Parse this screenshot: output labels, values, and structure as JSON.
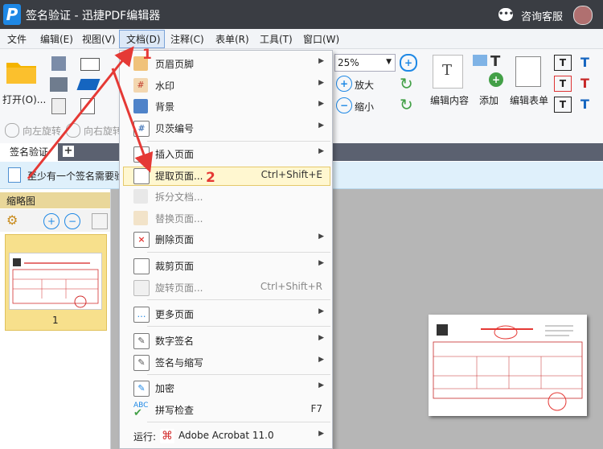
{
  "app": {
    "logo": "P",
    "title": "签名验证 - 迅捷PDF编辑器",
    "support": "咨询客服"
  },
  "menubar": [
    "文件",
    "编辑(E)",
    "视图(V)",
    "文档(D)",
    "注释(C)",
    "表单(R)",
    "工具(T)",
    "窗口(W)"
  ],
  "ribbon": {
    "open": "打开(O)...",
    "rotate_left": "向左旋转",
    "rotate_right": "向右旋转",
    "zoom_value": "25%",
    "zoom_in": "放大",
    "zoom_out": "缩小",
    "edit_content": "编辑内容",
    "add": "添加",
    "edit_form": "编辑表单"
  },
  "tabs": {
    "active": "签名验证",
    "add": "+"
  },
  "notification": "至少有一个签名需要验证",
  "thumbnails": {
    "title": "缩略图",
    "page_number": "1"
  },
  "dropdown": {
    "items": [
      {
        "label": "页眉页脚",
        "icon": "header-footer-icon",
        "submenu": true
      },
      {
        "label": "水印",
        "icon": "watermark-icon",
        "submenu": true
      },
      {
        "label": "背景",
        "icon": "background-icon",
        "submenu": true
      },
      {
        "label": "贝茨编号",
        "icon": "bates-number-icon",
        "submenu": true
      },
      {
        "label": "插入页面",
        "icon": "insert-page-icon",
        "submenu": true
      },
      {
        "label": "提取页面...",
        "icon": "extract-page-icon",
        "shortcut": "Ctrl+Shift+E",
        "highlighted": true
      },
      {
        "label": "拆分文档...",
        "icon": "split-document-icon",
        "disabled": true
      },
      {
        "label": "替换页面...",
        "icon": "replace-page-icon",
        "disabled": true
      },
      {
        "label": "删除页面",
        "icon": "delete-page-icon",
        "submenu": true
      },
      {
        "label": "裁剪页面",
        "icon": "crop-page-icon",
        "submenu": true
      },
      {
        "label": "旋转页面...",
        "icon": "rotate-page-icon",
        "shortcut": "Ctrl+Shift+R",
        "disabled": true
      },
      {
        "label": "更多页面",
        "icon": "more-pages-icon",
        "submenu": true
      },
      {
        "label": "数字签名",
        "icon": "digital-signature-icon",
        "submenu": true
      },
      {
        "label": "签名与缩写",
        "icon": "sign-initials-icon",
        "submenu": true
      },
      {
        "label": "加密",
        "icon": "encrypt-icon",
        "submenu": true
      },
      {
        "label": "拼写检查",
        "icon": "spell-check-icon",
        "shortcut": "F7"
      },
      {
        "label": "运行:",
        "app": "Adobe Acrobat 11.0",
        "icon": "acrobat-icon",
        "submenu": true
      }
    ],
    "spell_icon_text": "ABC"
  },
  "annotations": {
    "step1": "1",
    "step2": "2",
    "color": "#e53935"
  },
  "colors": {
    "titlebar": "#3a3d43",
    "accent": "#1e88e5",
    "highlight": "#fff7d0"
  }
}
